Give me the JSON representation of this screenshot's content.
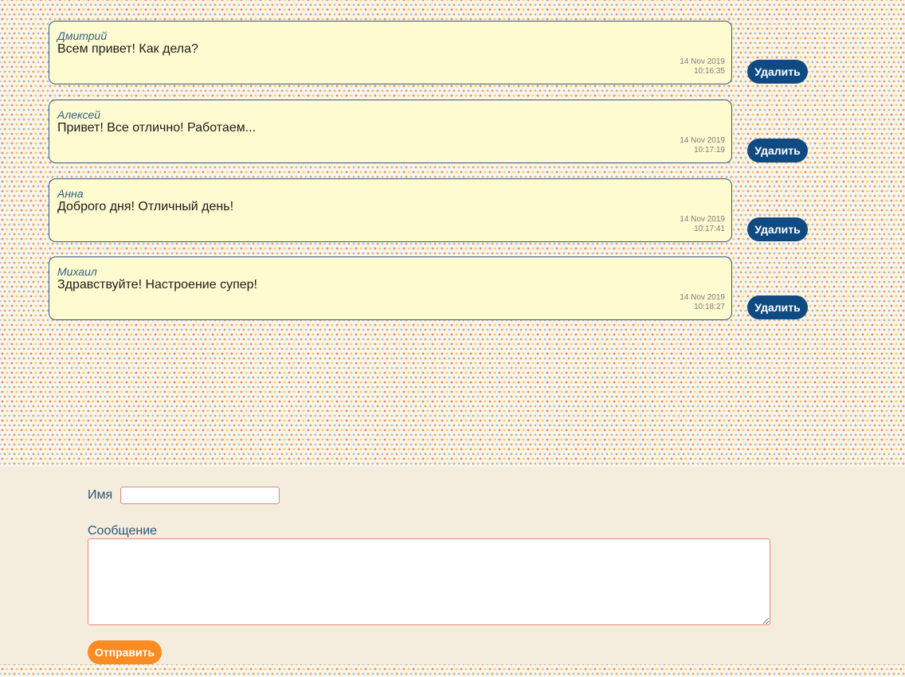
{
  "messages": [
    {
      "author": "Дмитрий",
      "text": "Всем привет! Как дела?",
      "date": "14 Nov 2019",
      "time": "10:16:35",
      "delete_label": "Удалить"
    },
    {
      "author": "Алексей",
      "text": "Привет! Все отлично! Работаем...",
      "date": "14 Nov 2019",
      "time": "10:17:19",
      "delete_label": "Удалить"
    },
    {
      "author": "Анна",
      "text": "Доброго дня! Отличный день!",
      "date": "14 Nov 2019",
      "time": "10:17:41",
      "delete_label": "Удалить"
    },
    {
      "author": "Михаил",
      "text": "Здравствуйте! Настроение супер!",
      "date": "14 Nov 2019",
      "time": "10:18:27",
      "delete_label": "Удалить"
    }
  ],
  "form": {
    "name_label": "Имя",
    "name_value": "",
    "message_label": "Сообщение",
    "message_value": "",
    "send_label": "Отправить"
  },
  "colors": {
    "card_bg": "#fffbd0",
    "delete_button": "#0f4b82",
    "send_button": "#fb8c23",
    "input_border": "#e38a76",
    "form_bg": "#f4ecdc"
  }
}
